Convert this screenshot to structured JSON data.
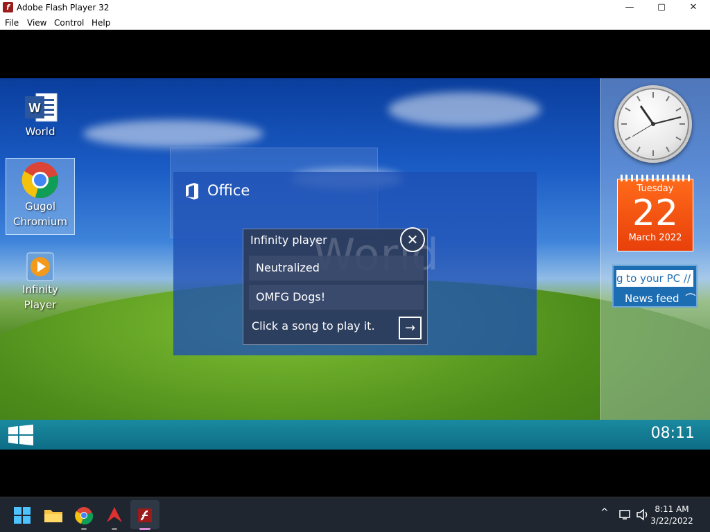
{
  "window": {
    "title": "Adobe Flash Player 32",
    "app_icon_glyph": "f",
    "controls": {
      "minimize": "—",
      "maximize": "▢",
      "close": "✕"
    }
  },
  "menu": [
    "File",
    "View",
    "Control",
    "Help"
  ],
  "desktop": {
    "icons": [
      {
        "name": "World",
        "icon": "word-doc-icon"
      },
      {
        "name": "Gugol Chromium",
        "line1": "Gugol",
        "line2": "Chromium",
        "icon": "chrome-icon",
        "selected": true
      },
      {
        "name": "Infinity Player",
        "line1": "Infinity",
        "line2": "Player",
        "icon": "play-icon"
      }
    ],
    "office_window": {
      "title": "Office"
    },
    "player": {
      "title": "Infinity player",
      "watermark": "World",
      "close_glyph": "✕",
      "songs": [
        "Neutralized",
        "OMFG Dogs!"
      ],
      "hint": "Click a song to play it.",
      "go_glyph": "→"
    },
    "gadgets": {
      "calendar": {
        "weekday": "Tuesday",
        "day": "22",
        "month_year": "March 2022"
      },
      "newsfeed": {
        "ticker": "g to your PC //",
        "label": "News feed",
        "rss_glyph": "⌒"
      }
    },
    "taskbar_time": "08:11"
  },
  "system_taskbar": {
    "apps": [
      "start-icon",
      "file-explorer-icon",
      "chrome-icon",
      "arrow-app-icon",
      "flash-player-icon"
    ],
    "tray_chevron": "^",
    "time": "8:11 AM",
    "date": "3/22/2022"
  },
  "colors": {
    "accent_office": "#1e50b4",
    "calendar": "#ff6a1a",
    "inner_taskbar": "#0d6d86"
  }
}
